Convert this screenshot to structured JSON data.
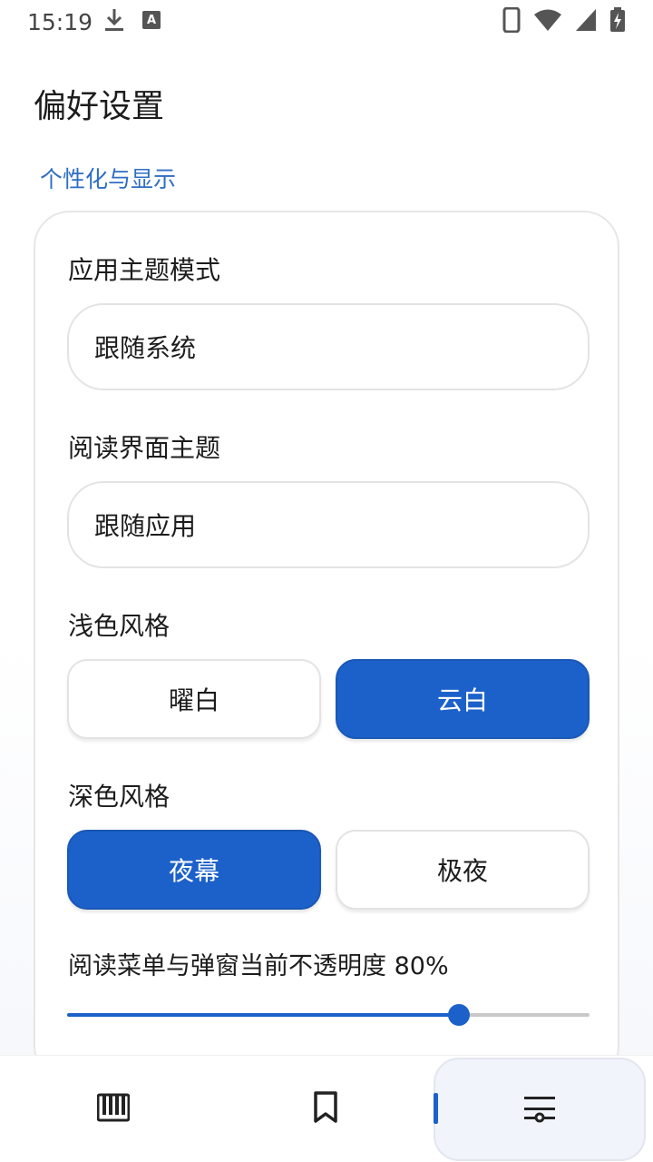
{
  "status_bar": {
    "time": "15:19",
    "left_icons": [
      "download-icon",
      "keyboard-a-icon"
    ],
    "right_icons": [
      "phone-icon",
      "wifi-icon",
      "cell-signal-icon",
      "battery-charging-icon"
    ]
  },
  "page": {
    "title": "偏好设置",
    "section": "个性化与显示"
  },
  "settings": {
    "app_theme_label": "应用主题模式",
    "app_theme_value": "跟随系统",
    "reader_theme_label": "阅读界面主题",
    "reader_theme_value": "跟随应用",
    "light_style_label": "浅色风格",
    "light_options": [
      {
        "label": "曜白",
        "selected": false
      },
      {
        "label": "云白",
        "selected": true
      }
    ],
    "dark_style_label": "深色风格",
    "dark_options": [
      {
        "label": "夜幕",
        "selected": true
      },
      {
        "label": "极夜",
        "selected": false
      }
    ],
    "opacity_label": "阅读菜单与弹窗当前不透明度 80%",
    "opacity_value": 0.75
  },
  "bottom_nav": {
    "items": [
      {
        "icon": "library-icon",
        "active": false
      },
      {
        "icon": "bookmark-icon",
        "active": false
      },
      {
        "icon": "settings-sliders-icon",
        "active": true
      }
    ]
  },
  "colors": {
    "accent": "#1c61ca",
    "section_label": "#2f6ec4"
  }
}
